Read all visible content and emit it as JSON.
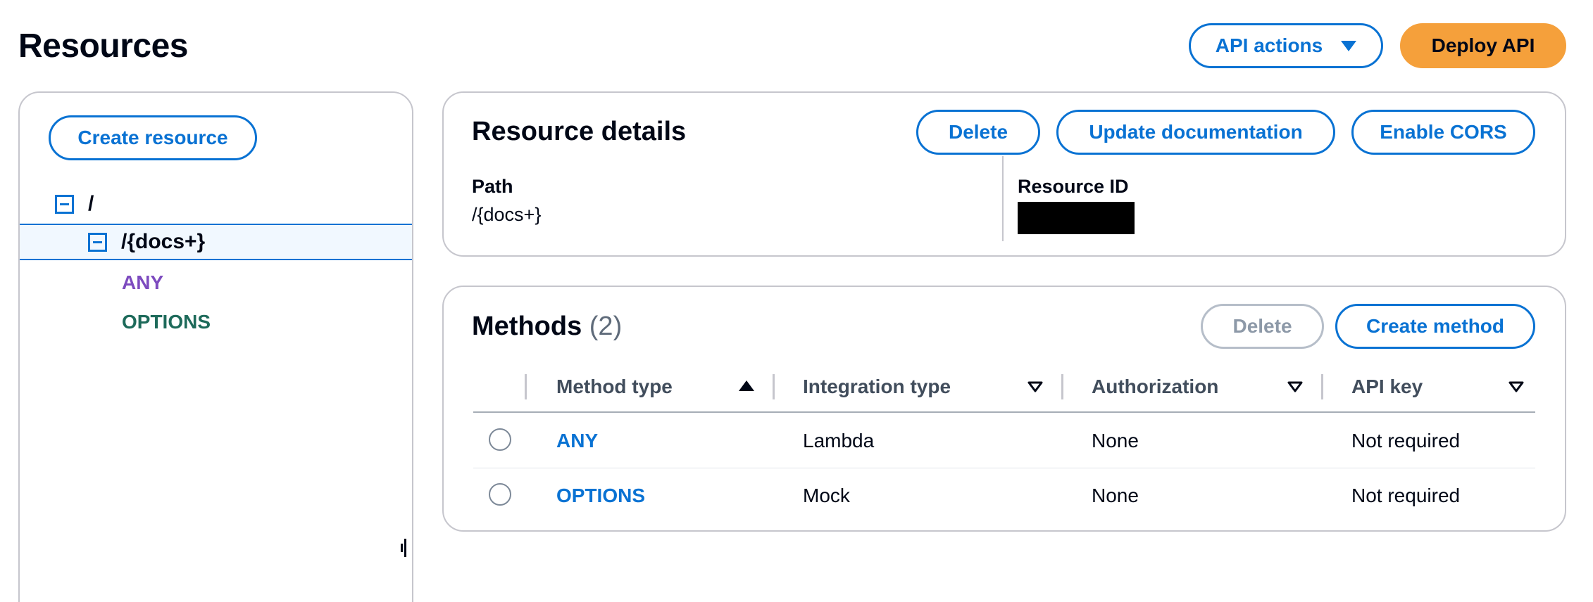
{
  "page": {
    "title": "Resources"
  },
  "header_actions": {
    "api_actions_label": "API actions",
    "deploy_label": "Deploy API"
  },
  "tree": {
    "create_resource_label": "Create resource",
    "nodes": [
      {
        "label": "/",
        "selected": false
      },
      {
        "label": "/{docs+}",
        "selected": true
      }
    ],
    "methods": [
      "ANY",
      "OPTIONS"
    ]
  },
  "resource_details": {
    "title": "Resource details",
    "delete_label": "Delete",
    "update_doc_label": "Update documentation",
    "enable_cors_label": "Enable CORS",
    "path_label": "Path",
    "path_value": "/{docs+}",
    "resource_id_label": "Resource ID"
  },
  "methods": {
    "title": "Methods",
    "count": "(2)",
    "delete_label": "Delete",
    "create_label": "Create method",
    "columns": [
      "Method type",
      "Integration type",
      "Authorization",
      "API key"
    ],
    "rows": [
      {
        "method": "ANY",
        "integration": "Lambda",
        "authorization": "None",
        "api_key": "Not required"
      },
      {
        "method": "OPTIONS",
        "integration": "Mock",
        "authorization": "None",
        "api_key": "Not required"
      }
    ]
  },
  "colors": {
    "accent": "#0972d3",
    "primary_button": "#f5a03b",
    "method_any": "#7d4bbf",
    "method_options": "#1d6a5a"
  }
}
